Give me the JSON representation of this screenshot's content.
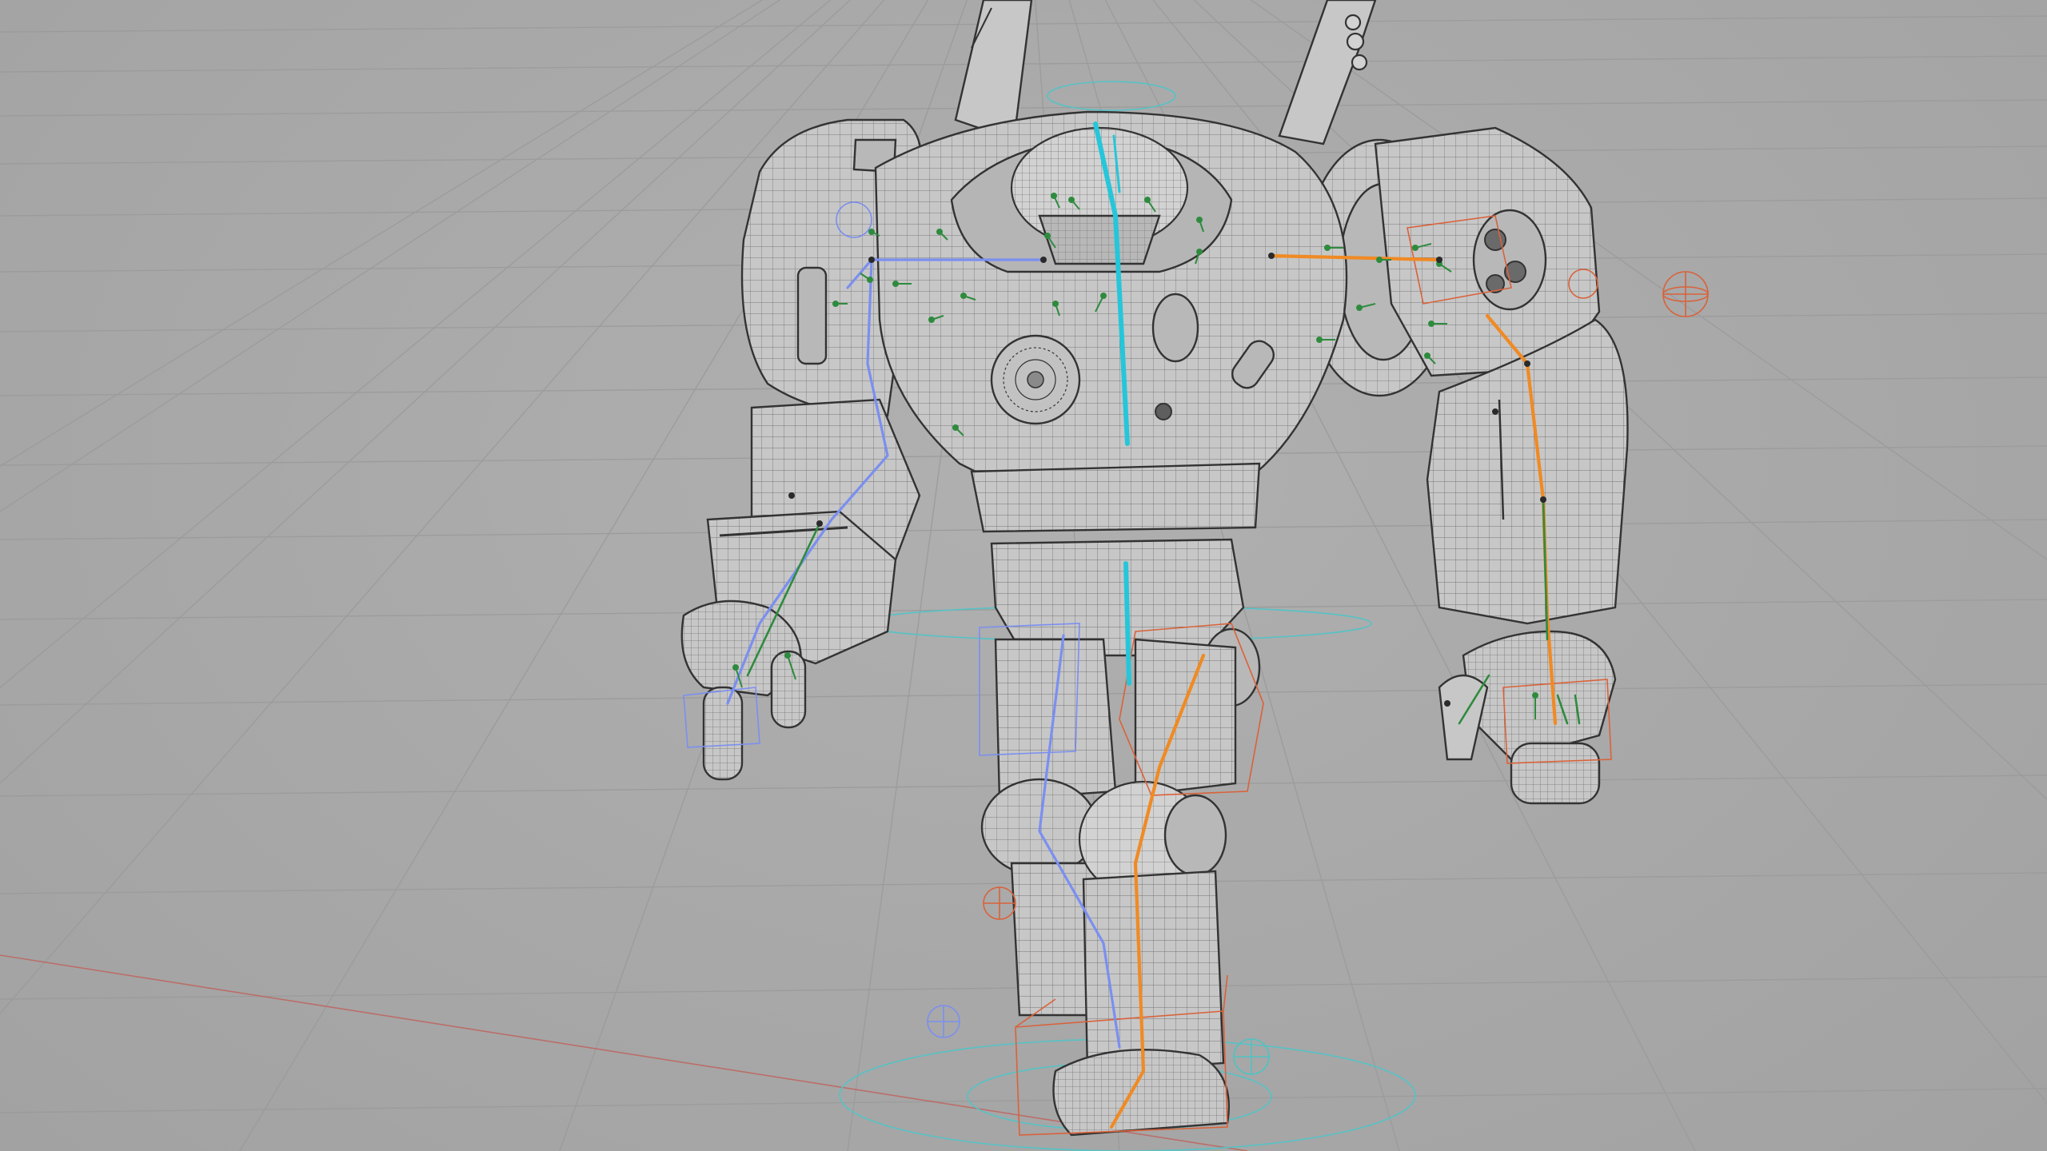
{
  "viewport": {
    "view_mode": "wireframe-on-shaded",
    "background_color": "#a9a9a9",
    "grid": true,
    "grid_color": "#9c9c9c",
    "x_axis_color": "#c0504d"
  },
  "model": {
    "object": "robot-mech",
    "wireframe_color": "#3a3a3a",
    "shell_color": "#c7c7c7"
  },
  "rig": {
    "spine_bone_color": "#26c6da",
    "left_chain_color": "#7b8ff0",
    "right_chain_color": "#f08a24",
    "face_joint_color": "#2e8b3e",
    "ground_control_color": "#4fc3c3",
    "ik_control_color": "#e06a3a"
  }
}
